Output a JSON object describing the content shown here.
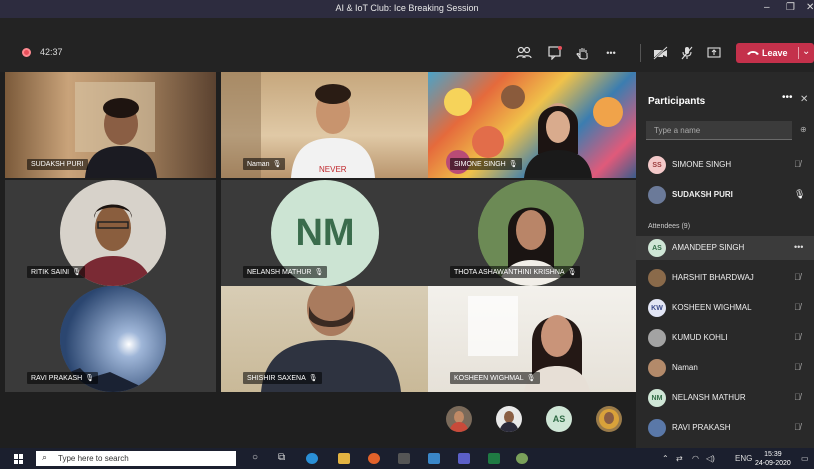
{
  "window": {
    "title": "AI & IoT Club: Ice Breaking Session",
    "minimize": "–",
    "restore": "❐",
    "close": "✕"
  },
  "toolbar": {
    "timer": "42:37",
    "more": "•••",
    "leave_label": "Leave"
  },
  "tiles": [
    {
      "name": "SUDAKSH PURI",
      "mic": ""
    },
    {
      "name": "Naman",
      "mic": "🎙"
    },
    {
      "name": "SIMONE SINGH",
      "mic": "🎙"
    },
    {
      "name": "RITIK SAINI",
      "mic": "🎙"
    },
    {
      "name": "NELANSH MATHUR",
      "mic": "🎙",
      "initials": "NM"
    },
    {
      "name": "THOTA ASHAWANTHINI KRISHNA",
      "mic": "🎙"
    },
    {
      "name": "RAVI PRAKASH",
      "mic": "🎙"
    },
    {
      "name": "SHISHIR SAXENA",
      "mic": "🎙"
    },
    {
      "name": "KOSHEEN WIGHMAL",
      "mic": "🎙"
    }
  ],
  "strip": {
    "initials": "AS"
  },
  "participants": {
    "title": "Participants",
    "more": "•••",
    "close": "✕",
    "search_placeholder": "Type a name",
    "attendees_label": "Attendees (9)",
    "presenters": [
      {
        "initials": "SS",
        "name": "SIMONE SINGH",
        "color": "#f3c9c9",
        "text": "#9a3b3b"
      },
      {
        "initials": "",
        "name": "SUDAKSH PURI",
        "color": "#6b7a99",
        "text": "#fff"
      }
    ],
    "attendees": [
      {
        "initials": "AS",
        "name": "AMANDEEP SINGH",
        "color": "#cfe6d6",
        "text": "#2f6b45",
        "more": "•••"
      },
      {
        "initials": "",
        "name": "HARSHIT BHARDWAJ",
        "color": "#8a6a4a",
        "text": "#fff"
      },
      {
        "initials": "KW",
        "name": "KOSHEEN WIGHMAL",
        "color": "#e2e6f5",
        "text": "#3a4a8a"
      },
      {
        "initials": "",
        "name": "KUMUD KOHLI",
        "color": "#a3a3a3",
        "text": "#fff"
      },
      {
        "initials": "",
        "name": "Naman",
        "color": "#b38a6a",
        "text": "#fff"
      },
      {
        "initials": "NM",
        "name": "NELANSH MATHUR",
        "color": "#cfe6d6",
        "text": "#2f6b45"
      },
      {
        "initials": "",
        "name": "RAVI PRAKASH",
        "color": "#5a78a8",
        "text": "#fff"
      }
    ]
  },
  "taskbar": {
    "search_placeholder": "Type here to search",
    "language": "ENG",
    "time": "15:39",
    "date": "24-09-2020"
  }
}
